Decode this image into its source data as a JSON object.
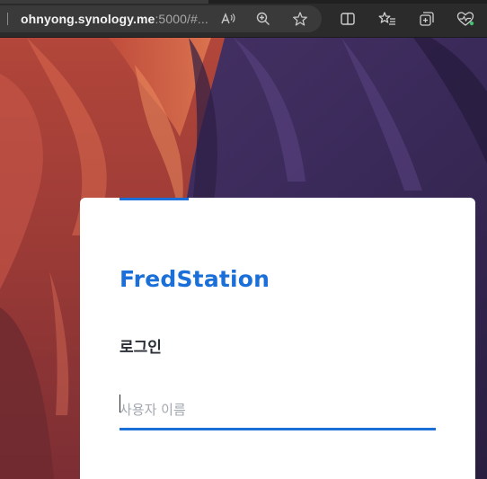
{
  "browser": {
    "url_host": "ohnyong.synology.me",
    "url_rest": ":5000/#...",
    "icons": {
      "read_aloud": "read-aloud-icon",
      "zoom": "zoom-in-icon",
      "favorite": "star-icon",
      "split_screen": "split-screen-icon",
      "favorites": "favorites-list-icon",
      "collections": "collections-icon",
      "browser_essentials": "heart-pulse-icon"
    }
  },
  "login": {
    "brand": "FredStation",
    "heading": "로그인",
    "username_placeholder": "사용자 이름",
    "username_value": ""
  },
  "colors": {
    "accent": "#1a6fd8",
    "text_dark": "#2b2f36",
    "toolbar": "#2b2b2b"
  }
}
